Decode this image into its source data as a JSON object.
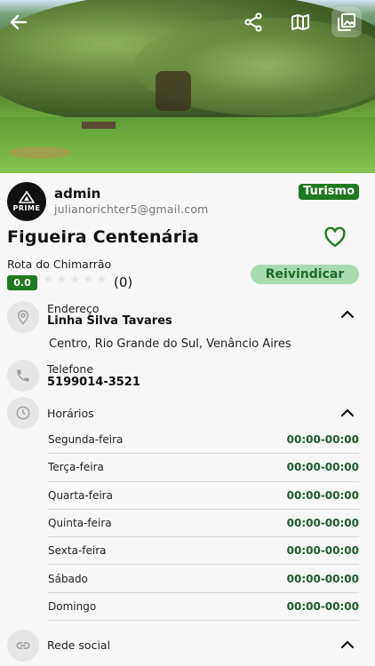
{
  "user": {
    "name": "admin",
    "email": "julianorichter5@gmail.com",
    "logo_text": "PRIME"
  },
  "category": "Turismo",
  "place": {
    "title": "Figueira Centenária",
    "route": "Rota do Chimarrão",
    "rating": "0.0",
    "review_count": "(0)",
    "stars_filled": 0,
    "stars_total": 5,
    "claim_label": "Reivindicar"
  },
  "address": {
    "label": "Endereço",
    "street": "Linha Silva Tavares",
    "line2": "Centro, Rio Grande do Sul, Venâncio Aires"
  },
  "phone": {
    "label": "Telefone",
    "number": "5199014-3521"
  },
  "hours": {
    "label": "Horários",
    "days": [
      {
        "day": "Segunda-feira",
        "time": "00:00-00:00"
      },
      {
        "day": "Terça-feira",
        "time": "00:00-00:00"
      },
      {
        "day": "Quarta-feira",
        "time": "00:00-00:00"
      },
      {
        "day": "Quinta-feira",
        "time": "00:00-00:00"
      },
      {
        "day": "Sexta-feira",
        "time": "00:00-00:00"
      },
      {
        "day": "Sábado",
        "time": "00:00-00:00"
      },
      {
        "day": "Domingo",
        "time": "00:00-00:00"
      }
    ]
  },
  "social": {
    "label": "Rede social"
  },
  "icons": [
    "back-arrow-icon",
    "share-icon",
    "map-icon",
    "gallery-icon",
    "heart-icon",
    "location-pin-icon",
    "phone-icon",
    "clock-icon",
    "link-icon",
    "chevron-up-icon"
  ],
  "colors": {
    "brand_green": "#1f7a1f",
    "claim_bg": "#a8dbb0",
    "time_text": "#1f5a2a"
  }
}
